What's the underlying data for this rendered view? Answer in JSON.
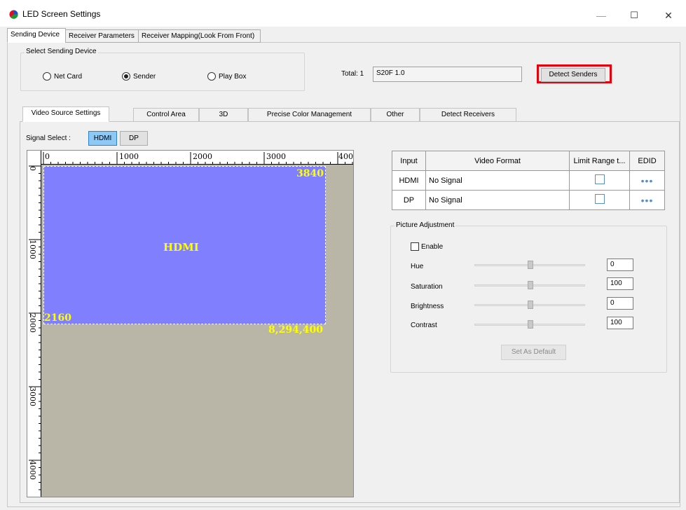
{
  "window": {
    "title": "LED Screen Settings",
    "minimize": "—",
    "maximize": "☐",
    "close": "✕"
  },
  "top_tabs": [
    "Sending Device",
    "Receiver Parameters",
    "Receiver Mapping(Look From Front)"
  ],
  "select_device": {
    "legend": "Select Sending Device",
    "options": [
      "Net Card",
      "Sender",
      "Play Box"
    ],
    "selected": "Sender"
  },
  "total_label": "Total: 1",
  "device_value": "S20F 1.0",
  "detect_senders": "Detect Senders",
  "inner_tabs": [
    "Video Source Settings",
    "Control Area",
    "3D",
    "Precise Color Management",
    "Other",
    "Detect Receivers"
  ],
  "signal": {
    "label": "Signal Select :",
    "options": [
      "HDMI",
      "DP"
    ],
    "selected": "HDMI"
  },
  "canvas": {
    "ruler_top": [
      "0",
      "1000",
      "2000",
      "3000",
      "400"
    ],
    "ruler_left": [
      "0",
      "1000",
      "2000",
      "3000",
      "4000"
    ],
    "region_label": "HDMI",
    "width_label": "3840",
    "height_label": "2160",
    "area_label": "8,294,400"
  },
  "table": {
    "headers": [
      "Input",
      "Video Format",
      "Limit Range t...",
      "EDID"
    ],
    "rows": [
      {
        "input": "HDMI",
        "format": "No Signal",
        "edid": "•••"
      },
      {
        "input": "DP",
        "format": "No Signal",
        "edid": "•••"
      }
    ]
  },
  "picture": {
    "legend": "Picture Adjustment",
    "enable": "Enable",
    "rows": [
      {
        "label": "Hue",
        "value": "0"
      },
      {
        "label": "Saturation",
        "value": "100"
      },
      {
        "label": "Brightness",
        "value": "0"
      },
      {
        "label": "Contrast",
        "value": "100"
      }
    ],
    "default_button": "Set As Default"
  },
  "colors": {
    "hdmi_fill": "#8080ff",
    "canvas_bg": "#b9b6a8",
    "highlight": "#e8000b",
    "label_yellow": "#ffff00"
  }
}
